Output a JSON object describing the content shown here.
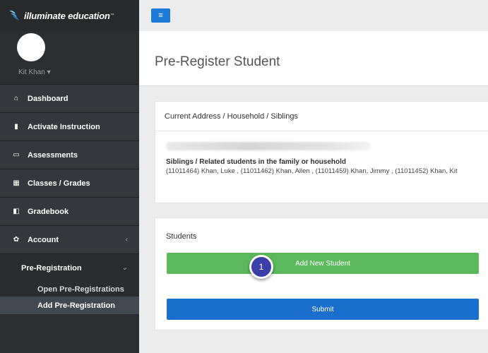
{
  "brand": {
    "name": "illuminate education",
    "tm": "™"
  },
  "user": {
    "name": "Kit Khan ▾"
  },
  "sidebar": {
    "items": [
      {
        "icon": "home-icon",
        "glyph": "⌂",
        "label": "Dashboard"
      },
      {
        "icon": "bookmark-icon",
        "glyph": "▮",
        "label": "Activate Instruction"
      },
      {
        "icon": "laptop-icon",
        "glyph": "▭",
        "label": "Assessments"
      },
      {
        "icon": "grid-icon",
        "glyph": "▦",
        "label": "Classes / Grades"
      },
      {
        "icon": "book-icon",
        "glyph": "◧",
        "label": "Gradebook"
      },
      {
        "icon": "gear-icon",
        "glyph": "✿",
        "label": "Account",
        "caret": "‹"
      }
    ],
    "section": {
      "label": "Pre-Registration",
      "caret": "⌄"
    },
    "sub_items": [
      {
        "label": "Open Pre-Registrations"
      },
      {
        "label": "Add Pre-Registration",
        "active": true
      }
    ]
  },
  "toolbar": {
    "menu_glyph": "≡"
  },
  "page": {
    "title": "Pre-Register Student"
  },
  "household_panel": {
    "heading": "Current Address / Household / Siblings",
    "siblings_title": "Siblings / Related students in the family or household",
    "siblings_text": "(11011464) Khan, Luke , (11011462) Khan, Allen , (11011459) Khan, Jimmy , (11011452) Khan, Kit"
  },
  "students_panel": {
    "label": "Students",
    "add_label": "Add New Student",
    "submit_label": "Submit"
  },
  "callout": {
    "number": "1"
  },
  "colors": {
    "sidebar": "#2b2e31",
    "primary": "#1a6fcc",
    "success": "#5cb85c",
    "callout": "#3b3fa8"
  }
}
